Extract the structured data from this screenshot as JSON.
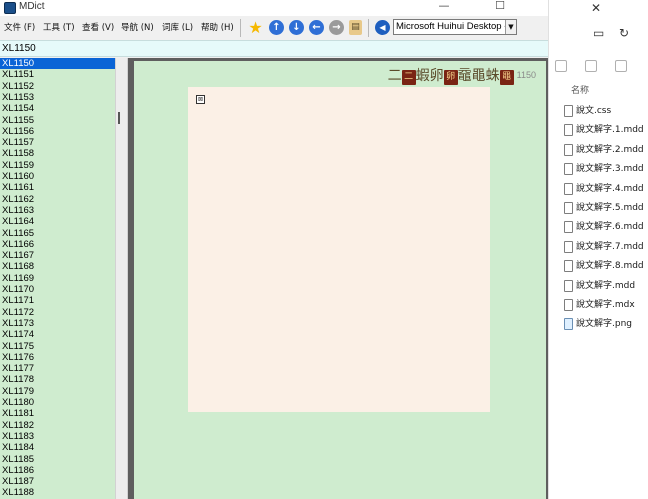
{
  "window": {
    "title": "MDict",
    "controls": {
      "minimize": "—",
      "maximize": "☐"
    }
  },
  "menu": [
    {
      "label": "文件 (F)"
    },
    {
      "label": "工具 (T)"
    },
    {
      "label": "查看 (V)"
    },
    {
      "label": "导航 (N)"
    },
    {
      "label": "词库 (L)"
    },
    {
      "label": "帮助 (H)"
    }
  ],
  "toolbar": {
    "dictionary_select": "Microsoft Huihui Desktop - C",
    "colors": {
      "star": "#f5b800",
      "nav": "#2f6fd6",
      "speaker": "#1f5fbf"
    }
  },
  "search": {
    "value": "XL1150"
  },
  "word_list": {
    "items": [
      "XL1150",
      "XL1151",
      "XL1152",
      "XL1153",
      "XL1154",
      "XL1155",
      "XL1156",
      "XL1157",
      "XL1158",
      "XL1159",
      "XL1160",
      "XL1161",
      "XL1162",
      "XL1163",
      "XL1164",
      "XL1165",
      "XL1166",
      "XL1167",
      "XL1168",
      "XL1169",
      "XL1170",
      "XL1171",
      "XL1172",
      "XL1173",
      "XL1174",
      "XL1175",
      "XL1176",
      "XL1177",
      "XL1178",
      "XL1179",
      "XL1180",
      "XL1181",
      "XL1182",
      "XL1183",
      "XL1184",
      "XL1185",
      "XL1186",
      "XL1187",
      "XL1188"
    ],
    "selected_index": 0
  },
  "entry": {
    "heading_prefix": "二",
    "box1": "二",
    "chars1": "蝦卵",
    "box2": "卵",
    "chars2": "黿黽蛛",
    "box3": "黽",
    "number": "1150"
  },
  "explorer": {
    "header": "名称",
    "files": [
      {
        "name": "說文.css",
        "type": "css"
      },
      {
        "name": "說文解字.1.mdd",
        "type": "mdd"
      },
      {
        "name": "說文解字.2.mdd",
        "type": "mdd"
      },
      {
        "name": "說文解字.3.mdd",
        "type": "mdd"
      },
      {
        "name": "說文解字.4.mdd",
        "type": "mdd"
      },
      {
        "name": "說文解字.5.mdd",
        "type": "mdd"
      },
      {
        "name": "說文解字.6.mdd",
        "type": "mdd"
      },
      {
        "name": "說文解字.7.mdd",
        "type": "mdd"
      },
      {
        "name": "說文解字.8.mdd",
        "type": "mdd"
      },
      {
        "name": "說文解字.mdd",
        "type": "mdd"
      },
      {
        "name": "說文解字.mdx",
        "type": "mdx"
      },
      {
        "name": "說文解字.png",
        "type": "png"
      }
    ]
  }
}
